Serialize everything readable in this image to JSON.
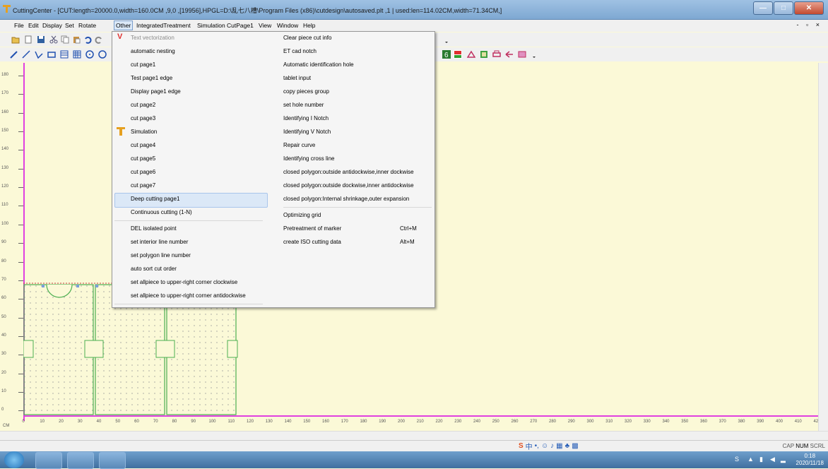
{
  "window": {
    "title": "CuttingCenter - [CUT:length=20000.0,width=160.0CM ,9,0 ,[19956],HPGL=D:\\乱七八槽\\Program Files (x86)\\cutdesign\\autosaved.plt ,1 | used:len=114.02CM,width=71.34CM,]",
    "minimize_label": "—",
    "maximize_label": "□",
    "close_label": "✕"
  },
  "menubar": {
    "items": [
      "File",
      "Edit",
      "Display",
      "Set",
      "Rotate",
      "Other",
      "IntegratedTreatment",
      "Simulation",
      "CutPage1",
      "View",
      "Window",
      "Help"
    ],
    "active": "Other",
    "mdi_controls": "- ▫ ×"
  },
  "dropdown": {
    "left_items": [
      {
        "label": "Text vectorization",
        "disabled": true,
        "icon": "v-icon"
      },
      {
        "label": "automatic nesting"
      },
      {
        "label": "cut page1"
      },
      {
        "label": "Test page1 edge"
      },
      {
        "label": "Display page1 edge"
      },
      {
        "label": "cut page2"
      },
      {
        "label": "cut page3"
      },
      {
        "label": "Simulation",
        "icon": "t-icon"
      },
      {
        "label": "cut page4"
      },
      {
        "label": "cut page5"
      },
      {
        "label": "cut page6"
      },
      {
        "label": "cut page7"
      },
      {
        "label": "Deep cutting page1",
        "highlighted": true
      },
      {
        "label": "Continuous cutting (1-N)"
      },
      {
        "label": "DEL isolated point"
      },
      {
        "label": "set interior line number"
      },
      {
        "label": "set polygon line number"
      },
      {
        "label": "auto sort cut order"
      },
      {
        "label": "set allpiece to upper-right corner clockwise"
      },
      {
        "label": "set allpiece to upper-right corner antidockwise"
      }
    ],
    "right_items": [
      {
        "label": "Clear piece cut info"
      },
      {
        "label": "ET cad notch"
      },
      {
        "label": "Automatic identification hole"
      },
      {
        "label": "tablet input"
      },
      {
        "label": "copy pieces group"
      },
      {
        "label": "set hole number"
      },
      {
        "label": "Identifying I Notch"
      },
      {
        "label": "Identifying V Notch"
      },
      {
        "label": "Repair curve"
      },
      {
        "label": "Identifying cross line"
      },
      {
        "label": "closed polygon:outside antidockwise,inner dockwise"
      },
      {
        "label": "closed polygon:outside dockwise,inner antidockwise"
      },
      {
        "label": "closed polygon:Internal shrinkage,outer expansion"
      },
      {
        "label": "Optimizing grid"
      },
      {
        "label": "Pretreatment of marker",
        "shortcut": "Ctrl+M"
      },
      {
        "label": "create ISO cutting data",
        "shortcut": "Alt+M"
      }
    ]
  },
  "ruler": {
    "unit": "CM",
    "vertical_ticks": [
      "180",
      "170",
      "160",
      "150",
      "140",
      "130",
      "120",
      "110",
      "100",
      "90",
      "80",
      "70",
      "60",
      "50",
      "40",
      "30",
      "20",
      "10",
      "0"
    ],
    "horizontal_ticks": [
      "0",
      "10",
      "20",
      "30",
      "40",
      "50",
      "60",
      "70",
      "80",
      "90",
      "100",
      "110",
      "120",
      "130",
      "140",
      "150",
      "160",
      "170",
      "180",
      "190",
      "200",
      "210",
      "220",
      "230",
      "240",
      "250",
      "260",
      "270",
      "280",
      "290",
      "300",
      "310",
      "320",
      "330",
      "340",
      "350",
      "360",
      "370",
      "380",
      "390",
      "400",
      "410",
      "420"
    ]
  },
  "statusbar": {
    "caps": "CAP",
    "num": "NUM",
    "scrl": "SCRL"
  },
  "taskbar": {
    "time": "0:18",
    "date": "2020/11/18"
  },
  "colors": {
    "canvas": "#fbf9d7",
    "ruler_axis": "#e040e0",
    "piece_outline": "#4caf50",
    "menu_highlight": "#dbe8f7"
  }
}
